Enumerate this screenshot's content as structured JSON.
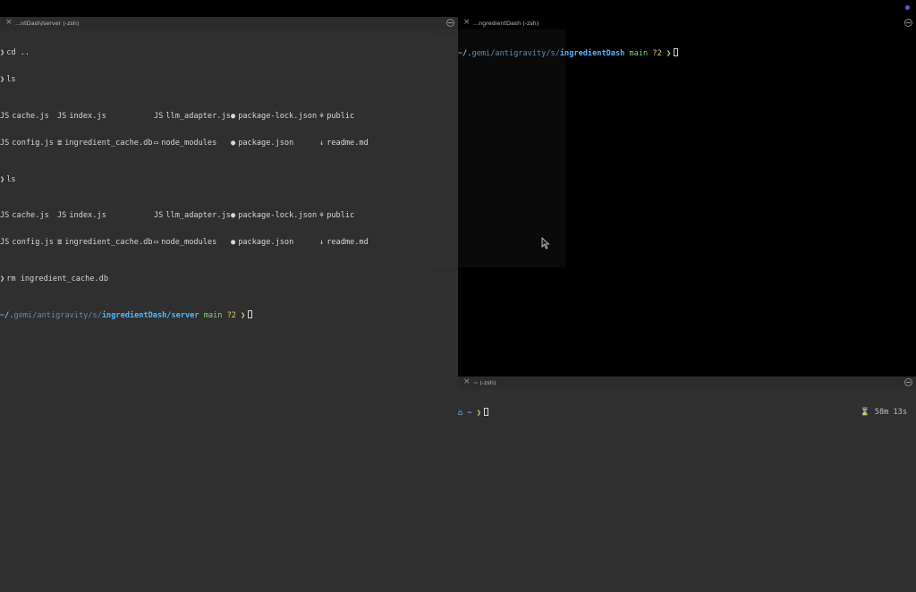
{
  "left_pane": {
    "title": "...ntDash/server (-zsh)",
    "lines": [
      {
        "prompt": "❯",
        "cmd": "cd .."
      },
      {
        "prompt": "❯",
        "cmd": "ls"
      }
    ],
    "ls1": [
      [
        "cache.js",
        "index.js",
        "llm_adapter.js",
        "package-lock.json",
        "public"
      ],
      [
        "config.js",
        "ingredient_cache.db",
        "node_modules",
        "package.json",
        "readme.md"
      ]
    ],
    "ls_cmd2": {
      "prompt": "❯",
      "cmd": "ls"
    },
    "ls2": [
      [
        "cache.js",
        "index.js",
        "llm_adapter.js",
        "package-lock.json",
        "public"
      ],
      [
        "config.js",
        "ingredient_cache.db",
        "node_modules",
        "package.json",
        "readme.md"
      ]
    ],
    "rm_cmd": {
      "prompt": "❯",
      "cmd": "rm ingredient_cache.db"
    },
    "prompt": {
      "os": "",
      "home": "~/.",
      "path_dim_1": "gemi",
      "path_sep_1": "/",
      "path_dim_2": "antigravity",
      "path_sep_2": "/s/",
      "path_bold": "ingredientDash/server",
      "sym": "",
      "branch_icon": "",
      "branch": "main",
      "status": "?2",
      "arrow": "❯"
    }
  },
  "top_right_pane": {
    "title": "...ngredientDash (-zsh)",
    "prompt": {
      "os": "",
      "home": "~/.",
      "path_dim_1": "gemi",
      "path_sep_1": "/",
      "path_dim_2": "antigravity",
      "path_sep_2": "/s/",
      "path_bold": "ingredientDash",
      "sym": "",
      "branch_icon": "",
      "branch": "main",
      "status": "?2",
      "arrow": "❯"
    }
  },
  "bottom_right_pane": {
    "title": "~ (-zsh)",
    "prompt": {
      "os": "",
      "home_icon": "⌂",
      "path": "~",
      "arrow": "❯"
    },
    "duration": "⌛ 58m 13s"
  },
  "icons": {
    "js": "JS",
    "db": "≣",
    "folder": "▭",
    "json": "●",
    "md": "↓",
    "public_icon": "⚘"
  },
  "colors": {
    "pane_bg": "#2f2f2f",
    "active_bg": "#000000",
    "path_bold": "#52b8ff",
    "branch": "#7fd37a",
    "status": "#e8d36a",
    "accent_dot": "#5b5bd6"
  }
}
